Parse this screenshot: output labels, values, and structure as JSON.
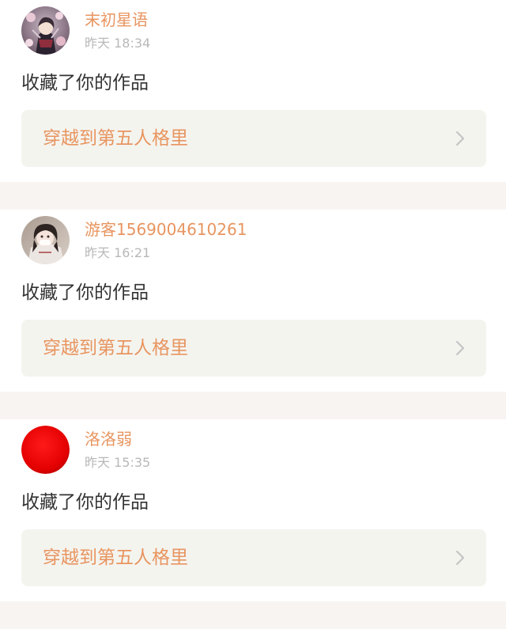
{
  "notifications": [
    {
      "username": "末初星语",
      "time": "昨天 18:34",
      "action": "收藏了你的作品",
      "work_title": "穿越到第五人格里",
      "avatar_icon": "anime-character-avatar",
      "chevron_icon": "chevron-right-icon"
    },
    {
      "username": "游客1569004610261",
      "time": "昨天 16:21",
      "action": "收藏了你的作品",
      "work_title": "穿越到第五人格里",
      "avatar_icon": "anime-character-avatar",
      "chevron_icon": "chevron-right-icon"
    },
    {
      "username": "洛洛弱",
      "time": "昨天 15:35",
      "action": "收藏了你的作品",
      "work_title": "穿越到第五人格里",
      "avatar_icon": "red-circle-avatar",
      "chevron_icon": "chevron-right-icon"
    }
  ],
  "colors": {
    "username": "#e89560",
    "work_title": "#e89560",
    "timestamp": "#b8b8b8",
    "action_text": "#333333",
    "card_background": "#f4f4ef",
    "divider": "#f8f4f2",
    "chevron": "#c4c4c4",
    "red_avatar": "#e30000"
  }
}
